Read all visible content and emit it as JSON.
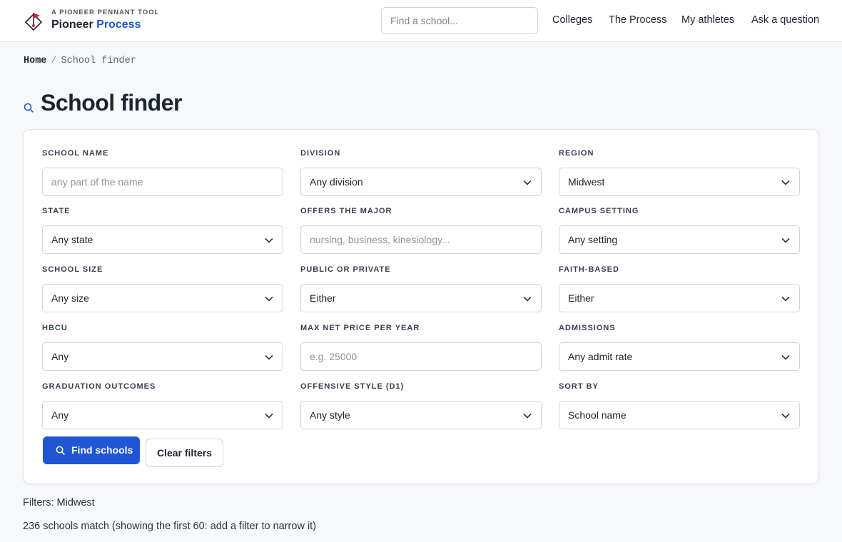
{
  "header": {
    "brand_sub": "A PIONEER PENNANT TOOL",
    "brand_name": "Pioneer",
    "brand_accent": "Process",
    "search_placeholder": "Find a school...",
    "nav": [
      "Colleges",
      "The Process",
      "My athletes",
      "Ask a question"
    ]
  },
  "breadcrumb": {
    "home": "Home",
    "separator": "/",
    "current": "School finder"
  },
  "page_title": "School finder",
  "filters": {
    "school_name": {
      "label": "SCHOOL NAME",
      "placeholder": "any part of the name",
      "value": ""
    },
    "division": {
      "label": "DIVISION",
      "value": "Any division"
    },
    "region": {
      "label": "REGION",
      "value": "Midwest"
    },
    "state": {
      "label": "STATE",
      "value": "Any state"
    },
    "major": {
      "label": "OFFERS THE MAJOR",
      "placeholder": "nursing, business, kinesiology...",
      "value": ""
    },
    "campus_setting": {
      "label": "CAMPUS SETTING",
      "value": "Any setting"
    },
    "school_size": {
      "label": "SCHOOL SIZE",
      "value": "Any size"
    },
    "public_private": {
      "label": "PUBLIC OR PRIVATE",
      "value": "Either"
    },
    "faith_based": {
      "label": "FAITH-BASED",
      "value": "Either"
    },
    "hbcu": {
      "label": "HBCU",
      "value": "Any"
    },
    "max_net_price": {
      "label": "MAX NET PRICE PER YEAR",
      "placeholder": "e.g. 25000",
      "value": ""
    },
    "admissions": {
      "label": "ADMISSIONS",
      "value": "Any admit rate"
    },
    "graduation": {
      "label": "GRADUATION OUTCOMES",
      "value": "Any"
    },
    "offensive_style": {
      "label": "OFFENSIVE STYLE (D1)",
      "value": "Any style"
    },
    "sort_by": {
      "label": "SORT BY",
      "value": "School name"
    }
  },
  "actions": {
    "find": "Find schools",
    "clear": "Clear filters"
  },
  "results": {
    "filters_text": "Filters: Midwest",
    "count_text": "236 schools match (showing the first 60: add a filter to narrow it)"
  },
  "colors": {
    "primary": "#1f56d4",
    "accent": "#1f56c8",
    "logo_red": "#d9232e"
  }
}
